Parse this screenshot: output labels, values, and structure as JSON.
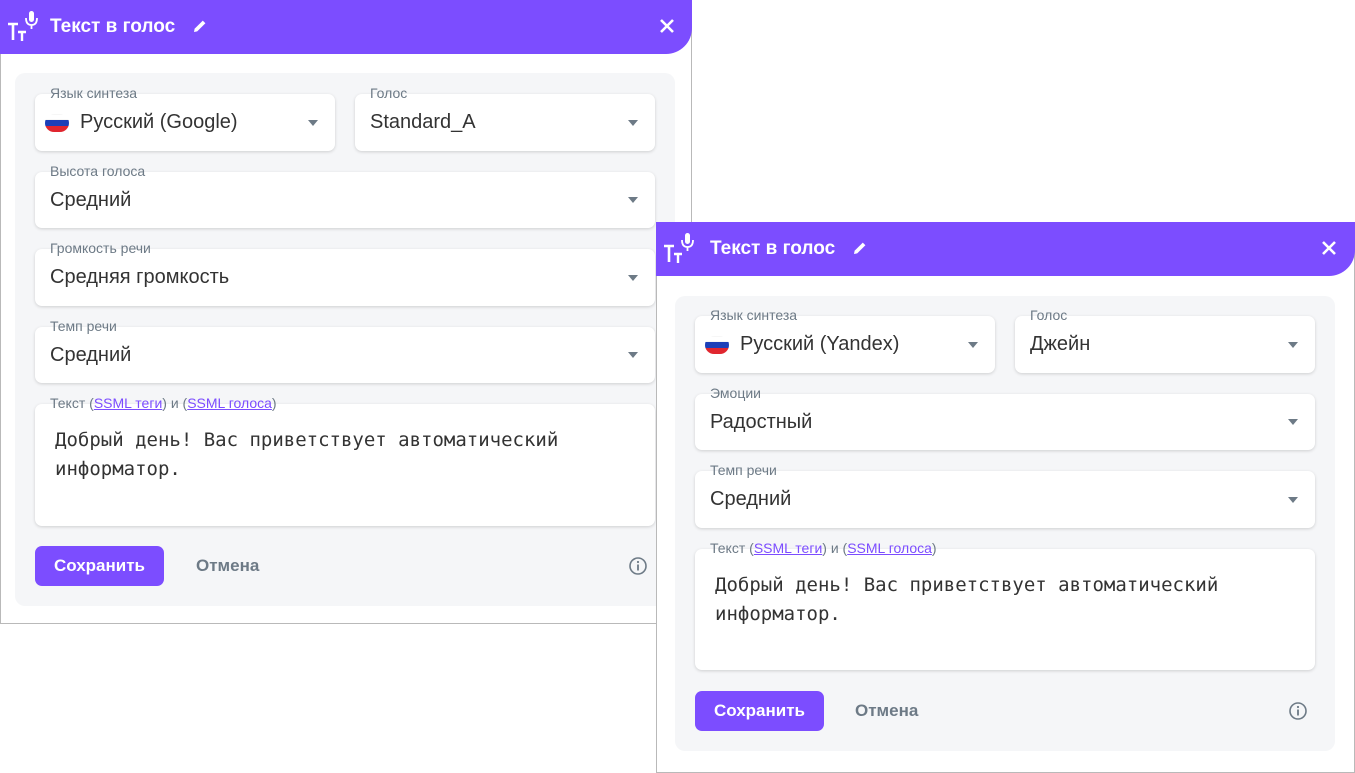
{
  "dialogs": [
    {
      "title": "Текст в голос",
      "language": {
        "label": "Язык синтеза",
        "value": "Русский (Google)"
      },
      "voice": {
        "label": "Голос",
        "value": "Standard_A"
      },
      "pitch": {
        "label": "Высота голоса",
        "value": "Средний"
      },
      "volume": {
        "label": "Громкость речи",
        "value": "Средняя громкость"
      },
      "rate": {
        "label": "Темп речи",
        "value": "Средний"
      },
      "text": {
        "label_prefix": "Текст (",
        "link1": "SSML теги",
        "label_mid": ") и (",
        "link2": "SSML голоса",
        "label_suffix": ")",
        "value": "Добрый день! Вас приветствует автоматический информатор."
      },
      "save_label": "Сохранить",
      "cancel_label": "Отмена"
    },
    {
      "title": "Текст в голос",
      "language": {
        "label": "Язык синтеза",
        "value": "Русский (Yandex)"
      },
      "voice": {
        "label": "Голос",
        "value": "Джейн"
      },
      "emotion": {
        "label": "Эмоции",
        "value": "Радостный"
      },
      "rate": {
        "label": "Темп речи",
        "value": "Средний"
      },
      "text": {
        "label_prefix": "Текст (",
        "link1": "SSML теги",
        "label_mid": ") и (",
        "link2": "SSML голоса",
        "label_suffix": ")",
        "value": "Добрый день! Вас приветствует автоматический информатор."
      },
      "save_label": "Сохранить",
      "cancel_label": "Отмена"
    }
  ],
  "colors": {
    "accent": "#7c4dff",
    "panel": "#f5f6f8",
    "label": "#6d7a86"
  },
  "icons": [
    "text-to-speech-icon",
    "pencil-icon",
    "close-icon",
    "russia-flag-icon",
    "dropdown-caret-icon",
    "info-icon"
  ]
}
